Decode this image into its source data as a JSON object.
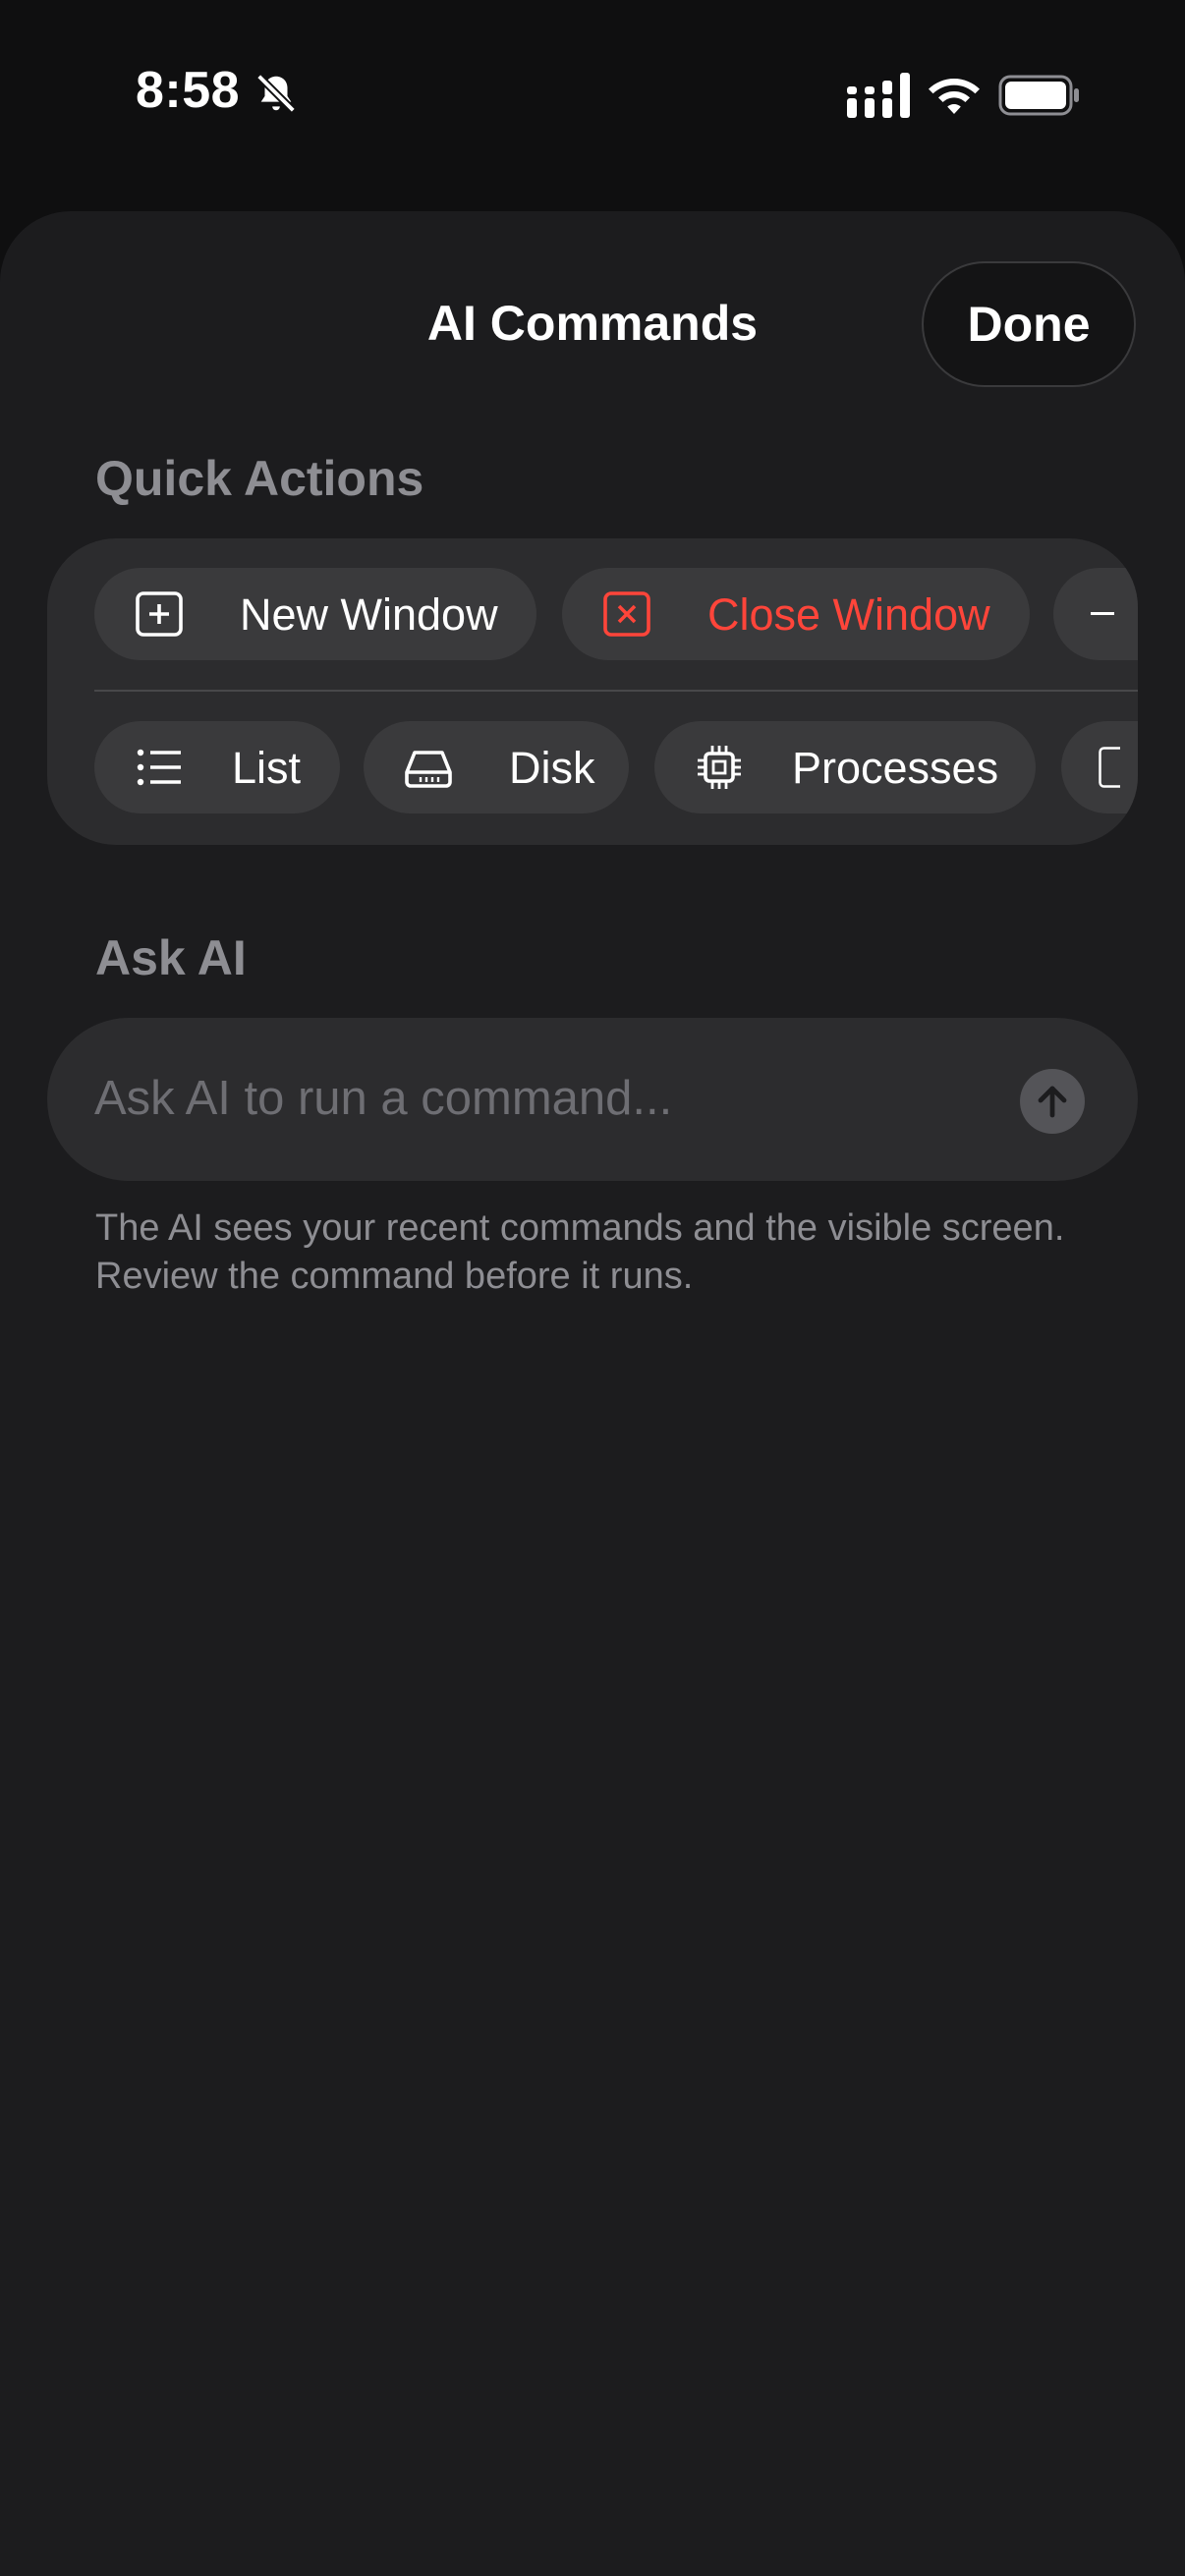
{
  "status_bar": {
    "time": "8:58",
    "icons": [
      "bell-slash-icon",
      "cellular-signal-icon",
      "wifi-icon",
      "battery-icon"
    ]
  },
  "sheet": {
    "title": "AI Commands",
    "done_label": "Done"
  },
  "quick_actions": {
    "header": "Quick Actions",
    "row1": [
      {
        "label": "New Window",
        "icon": "plus-square-icon",
        "style": "normal"
      },
      {
        "label": "Close Window",
        "icon": "xmark-square-icon",
        "style": "danger"
      },
      {
        "label": "",
        "icon": "partial-chip-icon",
        "style": "normal"
      }
    ],
    "row2": [
      {
        "label": "List",
        "icon": "list-icon"
      },
      {
        "label": "Disk",
        "icon": "disk-drive-icon"
      },
      {
        "label": "Processes",
        "icon": "cpu-chip-icon"
      },
      {
        "label": "",
        "icon": "partial-chip-icon"
      }
    ]
  },
  "ask_ai": {
    "header": "Ask AI",
    "placeholder": "Ask AI to run a command...",
    "value": "",
    "send_icon": "arrow-up-circle-icon",
    "hint": "The AI sees your recent commands and the visible screen. Review the command before it runs."
  },
  "colors": {
    "background": "#0f0f10",
    "sheet": "#1c1c1e",
    "panel": "#2c2c2e",
    "chip": "#3a3a3c",
    "danger": "#ff453a",
    "secondary_text": "#8e8e93"
  }
}
